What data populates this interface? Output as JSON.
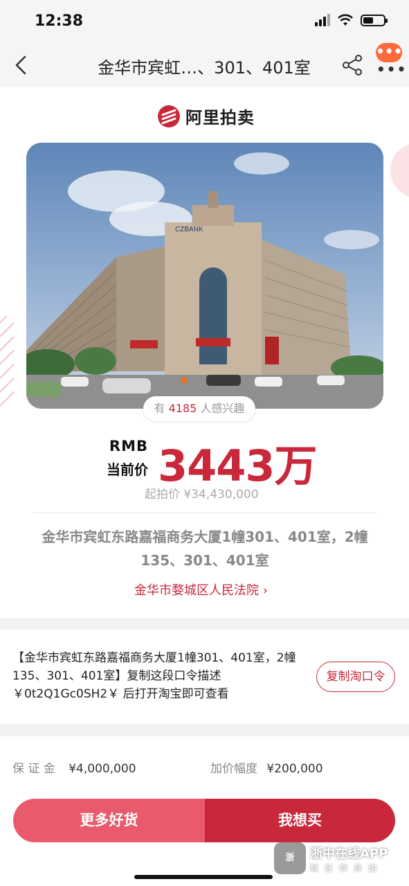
{
  "status_bar": {
    "time": "12:38"
  },
  "nav": {
    "title": "金华市宾虹…、301、401室",
    "badge": "•••"
  },
  "brand": {
    "name": "阿里拍卖"
  },
  "interest": {
    "prefix": "有",
    "count": "4185",
    "suffix": "人感兴趣"
  },
  "price": {
    "currency": "RMB",
    "label": "当前价",
    "value": "3443万",
    "start": "起拍价 ¥34,430,000"
  },
  "address": "金华市宾虹东路嘉福商务大厦1幢301、401室，2幢135、301、401室",
  "court": "金华市婺城区人民法院",
  "copy": {
    "text": "【金华市宾虹东路嘉福商务大厦1幢301、401室，2幢135、301、401室】复制这段口令描述￥0t2Q1Gc0SH2￥ 后打开淘宝即可查看",
    "button": "复制淘口令"
  },
  "footer": {
    "deposit_label": "保 证 金",
    "deposit_value": "¥4,000,000",
    "increment_label": "加价幅度",
    "increment_value": "¥200,000",
    "more_button": "更多好货",
    "buy_button": "我想买"
  },
  "watermark": {
    "logo": "浙",
    "title": "浙中在线APP",
    "subtitle": "就在你身边"
  },
  "colors": {
    "accent": "#c8283a",
    "accent_light": "#e85a6c"
  }
}
